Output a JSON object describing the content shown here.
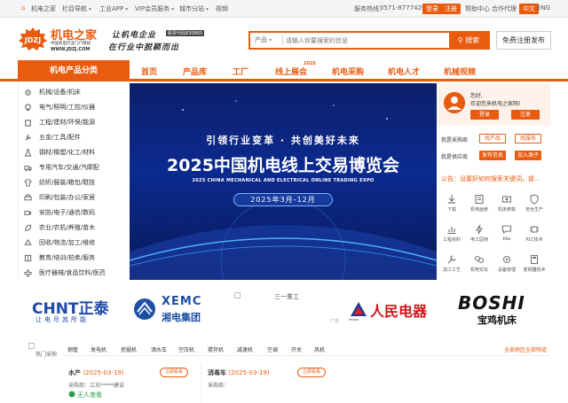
{
  "topbar": {
    "home": "机电之家",
    "nav_guide": "栏目导航",
    "app": "工业APP",
    "vip": "VIP会员服务",
    "city": "城市分站",
    "video": "视频",
    "hotline_label": "服务热线：",
    "hotline": "0571-87774297",
    "login": "登录",
    "register": "注册",
    "help": "帮助中心",
    "cooperate": "合作代理",
    "lang_cn": "中文",
    "lang_en": "ENG"
  },
  "header": {
    "logo_letters": "JDZJ",
    "logo_name": "机电之家",
    "logo_sub": "中国机电行业门户网站",
    "logo_url": "WWW.JDZJ.COM",
    "slogan1": "让机电企业",
    "slogan_badge": "股票代码830860",
    "slogan2": "在行业中脱颖而出",
    "search_category": "产品",
    "search_placeholder": "请输入你要搜索的信息",
    "search_button": "搜索",
    "free_signup": "免费注册发布"
  },
  "nav": {
    "category": "机电产品分类",
    "items": [
      "首页",
      "产品库",
      "工厂",
      "线上展会",
      "机电采购",
      "机电人才",
      "机械视频"
    ],
    "expo_tag": "2025"
  },
  "sidebar": {
    "items": [
      "机械/设备/机床",
      "电气/照明/工控/仪器",
      "工程/建材/环保/能源",
      "五金/工具/配件",
      "钢材/橡塑/化工/材料",
      "专用汽车/交通/汽摩配",
      "纺织/服装/箱包/鞋技",
      "印刷/包装/办公/家居",
      "安防/电子/通信/数码",
      "农业/农机/养殖/苗木",
      "回收/物流/加工/维修",
      "教育/培训/拍卖/服务",
      "医疗器械/食品饮料/医药"
    ]
  },
  "banner": {
    "line1": "引领行业变革 · 共创美好未来",
    "title": "2025中国机电线上交易博览会",
    "subtitle_en": "2025 CHINA MECHANICAL AND ELECTRICAL ONLINE TRADING EXPO",
    "date": "2025年3月-12月"
  },
  "user_panel": {
    "hello": "您好,",
    "welcome": "欢迎您来机电之家网!",
    "login": "登录",
    "register": "注册",
    "buyer_label": "我是采购商",
    "find_product": "找产品",
    "find_service": "找服务",
    "supplier_label": "我是供应商",
    "post_info": "发布信息",
    "join_vendor": "加入源子",
    "notice": "公告：设置好如何搜索关键词，提...",
    "grid": [
      "下载",
      "机电画册",
      "机床参数",
      "安全生产",
      "工程资料",
      "电工园地",
      "bbs",
      "PLC技术",
      "加工工艺",
      "机电论坛",
      "设备管理",
      "变频器技术"
    ]
  },
  "brands": {
    "brand1": "CHNT正泰",
    "brand1_sub": "让电尽其所能",
    "brand2": "XEMC",
    "brand2_sub": "湘电集团",
    "brand3": "三一重工",
    "brand4": "人民电器",
    "brand4_mark": "PEOPLE",
    "brand5": "BOSHI",
    "brand5_sub": "宝鸡机床",
    "ad_tag": "广告"
  },
  "bottom": {
    "hot_image_alt": "热门采购",
    "tags": [
      "钢管",
      "发电机",
      "挖掘机",
      "洒水车",
      "空压机",
      "搅拌机",
      "减速机",
      "空调",
      "开关",
      "风机"
    ],
    "all_link": "全部地区全部频道",
    "cards": [
      {
        "name": "水产",
        "date": "(2025-03-19)",
        "bid": "立即看看",
        "region_label": "采购商：",
        "region": "江苏*****建设"
      },
      {
        "name": "消毒车",
        "date": "(2025-03-19)",
        "bid": "立即看看",
        "region_label": "采购商："
      }
    ],
    "no_one": "无人查看"
  },
  "colors": {
    "accent": "#e95b0f",
    "banner": "#0b2a8f"
  }
}
